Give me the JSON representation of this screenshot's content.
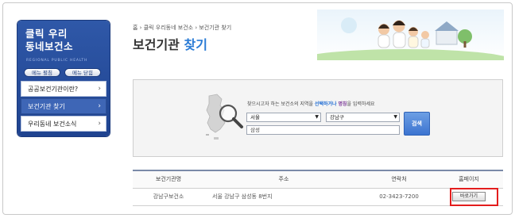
{
  "sidebar": {
    "title_line1": "클릭 우리",
    "title_line2": "동네보건소",
    "subtitle": "REGIONAL PUBLIC HEALTH",
    "expand_label": "메뉴 펼침",
    "collapse_label": "메뉴 닫힘",
    "items": [
      {
        "label": "공공보건기관이란?"
      },
      {
        "label": "보건기관 찾기"
      },
      {
        "label": "우리동네 보건소식"
      }
    ]
  },
  "header": {
    "breadcrumb": "홈 › 클릭 우리동네 보건소 › 보건기관 찾기",
    "title_main": "보건기관",
    "title_accent": "찾기"
  },
  "search": {
    "note_prefix": "찾으시고자 하는 보건소의 지역을 ",
    "note_blue": "선택하거나",
    "note_purple": "명칭",
    "note_suffix": "을 입력하세요",
    "city_value": "서울",
    "district_value": "강남구",
    "keyword_value": "삼성",
    "button_label": "검색"
  },
  "results": {
    "headers": [
      "보건기관명",
      "주소",
      "연락처",
      "홈페이지"
    ],
    "rows": [
      {
        "name": "강남구보건소",
        "address": "서울 강남구 삼성동 8번지",
        "phone": "02-3423-7200",
        "home_label": "바로가기"
      }
    ]
  },
  "colors": {
    "accent": "#2a7bd5",
    "sidebar": "#2f58a8",
    "highlight": "#e31d1d"
  }
}
